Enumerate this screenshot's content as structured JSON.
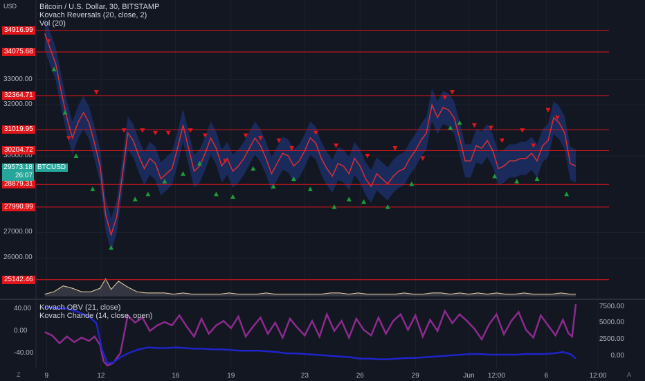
{
  "header": {
    "currency": "USD",
    "title": "Bitcoin / U.S. Dollar, 30, BITSTAMP",
    "indicator1": "Kovach Reversals (20, close, 2)",
    "indicator2": "Vol (20)"
  },
  "lower_pane": {
    "indicator1": "Kovach OBV (21, close)",
    "indicator2": "Kovach Chande (14, close, open)"
  },
  "price_tag": {
    "price": "29573.18",
    "countdown": "26:07",
    "symbol": "BTCUSD"
  },
  "colors": {
    "background": "#131722",
    "level": "#e0161b",
    "up": "#26a69a",
    "band": "#1f3a8a",
    "chande": "#8e2a8e",
    "obv": "#1e24c8"
  },
  "chart_data": [
    {
      "type": "line",
      "title": "Bitcoin / U.S. Dollar, 30, BITSTAMP",
      "ylim": [
        24700,
        35300
      ],
      "y_ticks": [
        "33000.00",
        "32000.00",
        "30000.00",
        "27000.00",
        "26000.00"
      ],
      "y_tick_values": [
        33000,
        32000,
        30000,
        27000,
        26000
      ],
      "levels": [
        "34916.99",
        "34075.68",
        "32364.71",
        "31019.95",
        "30204.72",
        "28879.31",
        "27990.99",
        "25142.46"
      ],
      "level_values": [
        34916.99,
        34075.68,
        32364.71,
        31019.95,
        30204.72,
        28879.31,
        27990.99,
        25142.46
      ],
      "x_ticks": [
        "9",
        "12",
        "16",
        "19",
        "23",
        "26",
        "29",
        "Jun",
        "12:00",
        "6",
        "12:00"
      ],
      "x": [
        8.9,
        9.2,
        9.5,
        9.8,
        10.1,
        10.4,
        10.7,
        11.0,
        11.3,
        11.6,
        11.9,
        12.2,
        12.5,
        12.8,
        13.1,
        13.4,
        13.7,
        14.0,
        14.3,
        14.6,
        14.9,
        15.2,
        15.5,
        15.8,
        16.1,
        16.4,
        16.7,
        17.0,
        17.3,
        17.6,
        17.9,
        18.2,
        18.5,
        18.8,
        19.1,
        19.4,
        19.7,
        20.0,
        20.3,
        20.6,
        20.9,
        21.2,
        21.5,
        21.8,
        22.1,
        22.4,
        22.7,
        23.0,
        23.3,
        23.6,
        23.9,
        24.2,
        24.5,
        24.8,
        25.1,
        25.4,
        25.7,
        26.0,
        26.3,
        26.6,
        26.9,
        27.2,
        27.5,
        27.8,
        28.1,
        28.4,
        28.7,
        29.0,
        29.3,
        29.6,
        29.9,
        30.2,
        30.5,
        30.8,
        31.1,
        31.4,
        31.7,
        32.0,
        32.3,
        32.6,
        32.9,
        33.2,
        33.5,
        33.8,
        34.1,
        34.4,
        34.7,
        35.0,
        35.3,
        35.6,
        35.9,
        36.2,
        36.5,
        36.8,
        37.1,
        37.4,
        37.7
      ],
      "series": [
        {
          "values": [
            34800,
            34200,
            33600,
            32500,
            31500,
            30700,
            31300,
            31700,
            31300,
            30500,
            29600,
            27700,
            26900,
            27600,
            29200,
            30900,
            30600,
            30000,
            29500,
            29900,
            29700,
            29100,
            29300,
            29500,
            30300,
            31200,
            30300,
            29400,
            29600,
            30100,
            30700,
            30300,
            29600,
            29900,
            29400,
            29600,
            29900,
            30300,
            30700,
            30400,
            29900,
            29300,
            29700,
            30100,
            30000,
            29600,
            29800,
            30200,
            30700,
            30500,
            29900,
            29500,
            29200,
            29700,
            29600,
            29300,
            29900,
            29600,
            29100,
            28800,
            29300,
            29100,
            28900,
            29200,
            29400,
            29500,
            29900,
            30200,
            30600,
            30900,
            32000,
            31500,
            31900,
            31800,
            31500,
            30700,
            29800,
            29800,
            30400,
            30300,
            30600,
            30200,
            29500,
            29600,
            29800,
            29800,
            29900,
            29900,
            30100,
            29800,
            30400,
            30600,
            31500,
            31300,
            30900,
            29700,
            29600
          ]
        }
      ],
      "reversal_up_x": [
        9.4,
        10.0,
        10.6,
        11.5,
        12.5,
        13.8,
        14.5,
        15.4,
        16.4,
        17.3,
        18.2,
        19.1,
        20.2,
        21.3,
        22.4,
        23.3,
        24.6,
        25.4,
        26.2,
        27.5,
        28.8,
        30.9,
        31.4,
        33.3,
        34.5,
        35.6,
        37.2
      ],
      "reversal_up_y": [
        33400,
        31700,
        30000,
        28700,
        26400,
        28300,
        28500,
        29000,
        29300,
        29700,
        28500,
        28400,
        29500,
        28800,
        29100,
        28700,
        28000,
        28300,
        28200,
        28000,
        28900,
        31100,
        31300,
        29200,
        29000,
        29100,
        28500
      ],
      "reversal_down_x": [
        9.1,
        10.2,
        11.7,
        13.2,
        14.2,
        14.9,
        15.6,
        16.8,
        17.6,
        18.7,
        19.8,
        20.6,
        21.6,
        22.3,
        23.6,
        24.7,
        26.4,
        27.9,
        29.4,
        30.6,
        31.0,
        32.2,
        33.1,
        33.7,
        34.8,
        35.4,
        36.2,
        36.7
      ],
      "reversal_down_y": [
        34500,
        30700,
        32500,
        31000,
        31000,
        30900,
        30900,
        31000,
        30800,
        29800,
        30800,
        30700,
        30600,
        30300,
        30900,
        30400,
        30000,
        30300,
        29900,
        32300,
        32500,
        31200,
        31100,
        30600,
        31000,
        30400,
        31800,
        31500
      ]
    },
    {
      "type": "area",
      "title": "Vol (20)",
      "x": [
        8.9,
        9.4,
        9.9,
        10.4,
        10.9,
        11.4,
        11.9,
        12.2,
        12.5,
        12.9,
        13.4,
        13.9,
        14.4,
        14.9,
        15.4,
        15.9,
        16.4,
        16.9,
        17.4,
        17.9,
        18.4,
        18.9,
        19.4,
        19.9,
        20.4,
        20.9,
        21.4,
        21.9,
        22.4,
        22.9,
        23.4,
        23.9,
        24.4,
        24.9,
        25.4,
        25.9,
        26.4,
        26.9,
        27.4,
        27.9,
        28.4,
        28.9,
        29.4,
        29.9,
        30.4,
        30.9,
        31.4,
        31.9,
        32.4,
        32.9,
        33.4,
        33.9,
        34.4,
        34.9,
        35.4,
        35.9,
        36.4,
        36.9,
        37.4,
        37.7
      ],
      "values": [
        2,
        4,
        9,
        7,
        4,
        4,
        7,
        15,
        6,
        13,
        8,
        4,
        3,
        3,
        3,
        2,
        3,
        2,
        2,
        2,
        2,
        3,
        2,
        2,
        2,
        3,
        2,
        2,
        2,
        2,
        2,
        2,
        3,
        3,
        2,
        3,
        2,
        2,
        2,
        2,
        3,
        2,
        2,
        3,
        3,
        2,
        3,
        2,
        3,
        2,
        3,
        2,
        2,
        3,
        2,
        2,
        2,
        3,
        2,
        2
      ],
      "ylim": [
        0,
        20
      ]
    },
    {
      "type": "line",
      "title": "Kovach Chande (14, close, open)",
      "y_ticks": [
        "40.00",
        "0.00",
        "-40.00"
      ],
      "y_tick_values": [
        40,
        0,
        -40
      ],
      "ylim": [
        -65,
        52
      ],
      "x": [
        8.9,
        9.3,
        9.7,
        10.1,
        10.5,
        10.9,
        11.3,
        11.6,
        11.9,
        12.1,
        12.3,
        12.6,
        13.0,
        13.4,
        13.8,
        14.2,
        14.6,
        15.0,
        15.4,
        15.8,
        16.2,
        16.6,
        17.0,
        17.4,
        17.8,
        18.2,
        18.6,
        19.0,
        19.4,
        19.8,
        20.2,
        20.6,
        21.0,
        21.4,
        21.8,
        22.2,
        22.6,
        23.0,
        23.4,
        23.8,
        24.2,
        24.6,
        25.0,
        25.4,
        25.8,
        26.2,
        26.6,
        27.0,
        27.4,
        27.8,
        28.2,
        28.6,
        29.0,
        29.4,
        29.8,
        30.2,
        30.6,
        31.0,
        31.4,
        31.8,
        32.2,
        32.6,
        33.0,
        33.4,
        33.8,
        34.2,
        34.6,
        35.0,
        35.4,
        35.8,
        36.2,
        36.6,
        37.0,
        37.3,
        37.5,
        37.7
      ],
      "values": [
        -2,
        -8,
        -22,
        -10,
        -20,
        -12,
        -18,
        -10,
        -25,
        -55,
        -62,
        -58,
        -40,
        28,
        15,
        24,
        0,
        10,
        16,
        10,
        28,
        8,
        -10,
        22,
        -5,
        10,
        18,
        5,
        26,
        -10,
        8,
        24,
        -5,
        15,
        -12,
        22,
        6,
        -8,
        18,
        -10,
        30,
        0,
        18,
        -12,
        22,
        2,
        -8,
        24,
        -5,
        18,
        30,
        2,
        28,
        -10,
        20,
        0,
        36,
        14,
        30,
        18,
        4,
        -15,
        12,
        30,
        -6,
        18,
        34,
        2,
        -12,
        28,
        10,
        -8,
        20,
        -4,
        -10,
        48
      ]
    },
    {
      "type": "line",
      "title": "Kovach OBV (21, close)",
      "y_ticks": [
        "7500.00",
        "5000.00",
        "2500.00",
        "0.00"
      ],
      "y_tick_values": [
        7500,
        5000,
        2500,
        0
      ],
      "ylim": [
        -1700,
        8200
      ],
      "x": [
        8.9,
        9.5,
        10.1,
        10.7,
        11.3,
        11.7,
        12.0,
        12.3,
        12.6,
        13.0,
        13.5,
        14.0,
        14.5,
        15.0,
        15.5,
        16.0,
        16.5,
        17.0,
        17.5,
        18.0,
        18.5,
        19.0,
        19.5,
        20.0,
        20.5,
        21.0,
        21.5,
        22.0,
        22.5,
        23.0,
        23.5,
        24.0,
        24.5,
        25.0,
        25.5,
        26.0,
        26.5,
        27.0,
        27.5,
        28.0,
        28.5,
        29.0,
        29.5,
        30.0,
        30.5,
        31.0,
        31.5,
        32.0,
        32.5,
        33.0,
        33.5,
        34.0,
        34.5,
        35.0,
        35.5,
        36.0,
        36.5,
        37.0,
        37.4,
        37.7
      ],
      "values": [
        7400,
        7300,
        7200,
        6700,
        6000,
        5000,
        1000,
        -1100,
        -1000,
        -200,
        500,
        1000,
        1300,
        1200,
        1200,
        1300,
        1200,
        1100,
        1100,
        1000,
        1000,
        900,
        800,
        800,
        800,
        700,
        600,
        400,
        400,
        300,
        200,
        100,
        0,
        -100,
        -200,
        -400,
        -400,
        -500,
        -500,
        -400,
        -300,
        -300,
        -200,
        -100,
        0,
        100,
        200,
        300,
        300,
        200,
        200,
        200,
        200,
        300,
        300,
        300,
        400,
        600,
        300,
        -400
      ]
    }
  ]
}
